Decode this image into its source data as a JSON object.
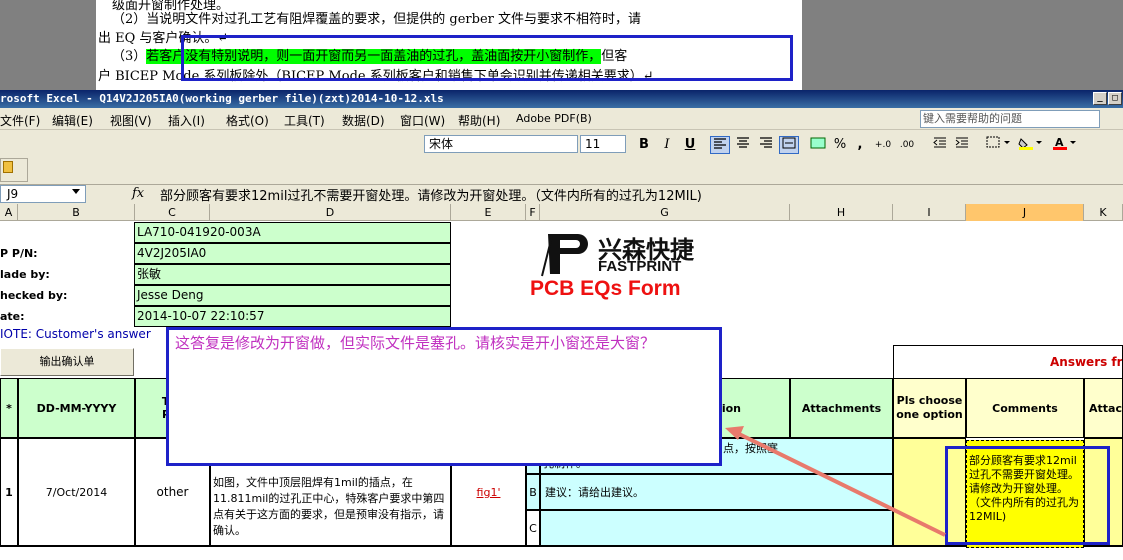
{
  "doc": {
    "line1": "级面开窗制作处理。",
    "line2": "（2）当说明文件对过孔工艺有阻焊覆盖的要求，但提供的 gerber 文件与要求不相符时，请",
    "line3": "出 EQ 与客户确认。↵",
    "line4_prefix": "（3）",
    "line4_highlight": "若客户没有特别说明，则一面开窗而另一面盖油的过孔，盖油面按开小窗制作，",
    "line4_suffix": "但客",
    "line5": "户 BICEP Mode 系列板除外（BICEP Mode 系列板客户和销售下单会识别并传递相关要求）↵"
  },
  "window": {
    "title": "rosoft Excel - Q14V2J205IA0(working gerber file)(zxt)2014-10-12.xls",
    "btn_min": "_",
    "btn_max": "□"
  },
  "menu": {
    "items": [
      "文件(F)",
      "编辑(E)",
      "视图(V)",
      "插入(I)",
      "格式(O)",
      "工具(T)",
      "数据(D)",
      "窗口(W)",
      "帮助(H)",
      "Adobe PDF(B)"
    ],
    "help_placeholder": "键入需要帮助的问题"
  },
  "toolbar": {
    "font": "宋体",
    "size": "11",
    "bold": "B",
    "italic": "I",
    "underline": "U",
    "percent": "%",
    "comma": ",",
    "inc_decimal": "+.0",
    "dec_decimal": ".00"
  },
  "formula": {
    "namebox": "J9",
    "fx": "fx",
    "content": "部分顾客有要求12mil过孔不需要开窗处理。请修改为开窗处理。（文件内所有的过孔为12MIL)"
  },
  "columns": [
    "A",
    "B",
    "C",
    "D",
    "E",
    "F",
    "G",
    "H",
    "I",
    "J",
    "K"
  ],
  "info": {
    "labels": [
      "P P/N:",
      "lade by:",
      "hecked by:",
      "ate:"
    ],
    "values": [
      "LA710-041920-003A",
      "4V2J205IA0",
      "张敏",
      "Jesse Deng",
      "2014-10-07 22:10:57"
    ],
    "note": "IOTE: Customer's  answer"
  },
  "logo": {
    "cn": "兴森快捷",
    "en": "FASTPRINT",
    "form_title": "PCB EQs Form"
  },
  "output_button": "输出确认单",
  "answers_header": "Answers fr",
  "headers": {
    "star": "*",
    "date": "DD-MM-YYYY",
    "type": "Typ\nPro",
    "question": "ion",
    "attachments": "Attachments",
    "choose": "Pls choose one option",
    "comments": "Comments",
    "attach2": "Attach"
  },
  "row1": {
    "num": "1",
    "date": "7/Oct/2014",
    "type": "other",
    "desc": "如图，文件中顶层阻焊有1mil的插点，在11.811mil的过孔正中心，特殊客户要求中第四点有关于这方面的要求，但是预审没有指示，请确认。",
    "link": "fig1'",
    "optB_label": "B",
    "optB_text": "建议：请给出建议。",
    "optC_label": "C",
    "optA_text": "点，按照塞",
    "optA_text2": "孔制作。"
  },
  "popup_text": "这答复是修改为开窗做，但实际文件是塞孔。请核实是开小窗还是大窗？",
  "comment_cell": "部分顾客有要求12mil过孔不需要开窗处理。请修改为开窗处理。（文件内所有的过孔为12MIL)",
  "colors": {
    "highlight_box": "#1e22c8",
    "popup_text": "#c030c0",
    "arrow": "#e87a6c",
    "form_title": "#ee1111"
  }
}
